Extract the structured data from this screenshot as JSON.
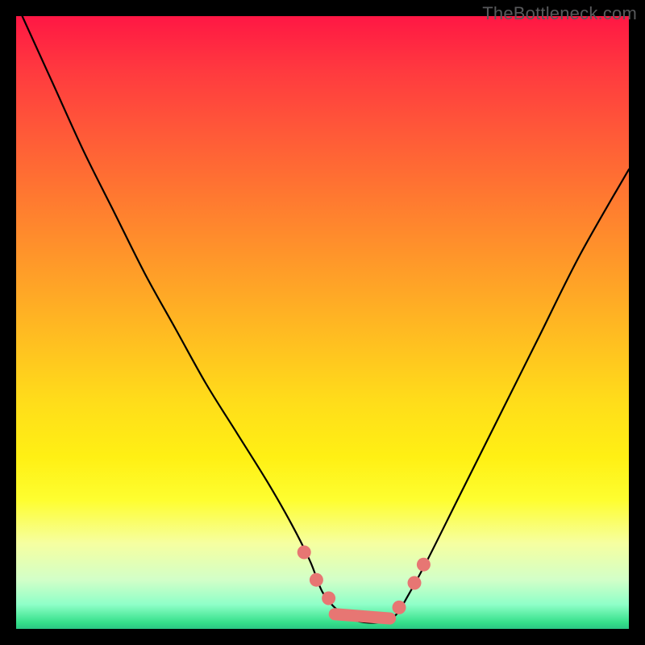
{
  "watermark": "TheBottleneck.com",
  "colors": {
    "frame_bg": "#000000",
    "curve": "#000000",
    "marker": "#e77673",
    "gradient_top": "#ff1744",
    "gradient_mid": "#ffdd1a",
    "gradient_bottom": "#2bc784"
  },
  "chart_data": {
    "type": "line",
    "title": "",
    "xlabel": "",
    "ylabel": "",
    "xlim": [
      0,
      100
    ],
    "ylim": [
      0,
      100
    ],
    "grid": false,
    "series": [
      {
        "name": "bottleneck-curve",
        "x": [
          1,
          6,
          11,
          16,
          21,
          26,
          31,
          36,
          41,
          45,
          48,
          50,
          52.5,
          55,
          57.5,
          60,
          62,
          64,
          67,
          72,
          78,
          85,
          92,
          100
        ],
        "y": [
          100,
          89,
          78,
          68,
          58,
          49,
          40,
          32,
          24,
          17,
          11,
          6,
          3,
          1.5,
          1.0,
          1.2,
          2.3,
          5.5,
          11,
          21,
          33,
          47,
          61,
          75
        ]
      }
    ],
    "markers": [
      {
        "x": 47.0,
        "y": 12.5
      },
      {
        "x": 49.0,
        "y": 8.0
      },
      {
        "x": 51.0,
        "y": 5.0
      },
      {
        "x": 62.5,
        "y": 3.5
      },
      {
        "x": 65.0,
        "y": 7.5
      },
      {
        "x": 66.5,
        "y": 10.5
      }
    ],
    "highlight_segment": {
      "x1": 52.0,
      "x2": 61.0,
      "y1": 2.4,
      "y2": 1.7
    }
  }
}
